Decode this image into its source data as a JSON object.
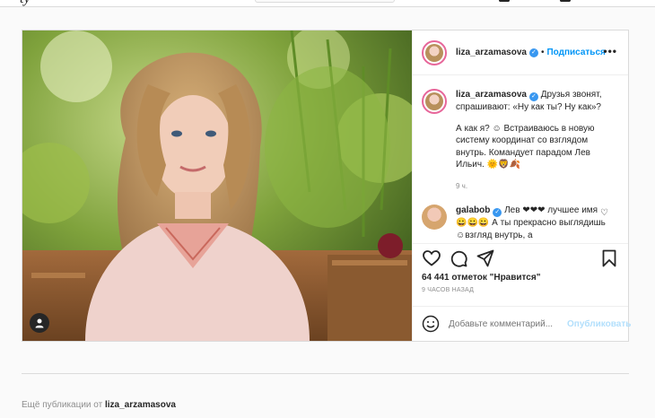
{
  "topbar": {
    "logo_fragment": "ty"
  },
  "post": {
    "author": "liza_arzamasova",
    "header": {
      "dot": "•",
      "follow_label": "Подписаться",
      "more_icon": "more-horizontal-icon"
    },
    "caption": {
      "line1": " Друзья звонят, спрашивают: «Ну как ты? Ну как»?",
      "line2": "А как я? ☺ Встраиваюсь в новую систему координат со взглядом внутрь. Командует парадом Лев Ильич. 🌞🦁🍂",
      "time": "9 ч."
    },
    "comment": {
      "author": "galabob",
      "text": " Лев ❤❤❤ лучшее имя😀😀😀 А ты прекрасно выглядишь☺взгляд внутрь, а"
    },
    "likes": "64 441 отметок \"Нравится\"",
    "post_time": "9 ЧАСОВ НАЗАД",
    "add_comment": {
      "placeholder": "Добавьте комментарий...",
      "publish_label": "Опубликовать"
    }
  },
  "more_posts": {
    "prefix": "Ещё публикации от ",
    "author": "liza_arzamasova"
  },
  "colors": {
    "accent": "#0095f6",
    "verified": "#3897f0",
    "publish_disabled": "#b2dffc",
    "border": "#dbdbdb"
  }
}
